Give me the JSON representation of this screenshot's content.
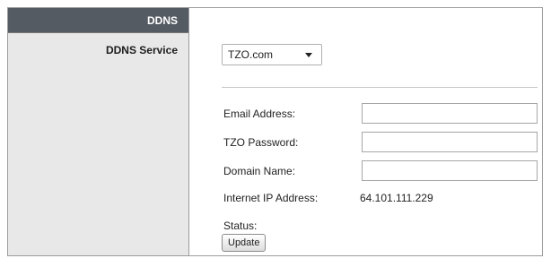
{
  "sidebar": {
    "header": "DDNS",
    "items": [
      {
        "label": "DDNS Service"
      }
    ]
  },
  "main": {
    "ddns_service": {
      "selected": "TZO.com"
    },
    "fields": {
      "email_label": "Email Address:",
      "password_label": "TZO Password:",
      "domain_label": "Domain Name:",
      "ip_label": "Internet IP Address:",
      "ip_value": "64.101.111.229",
      "status_label": "Status:"
    },
    "update_button": "Update"
  }
}
